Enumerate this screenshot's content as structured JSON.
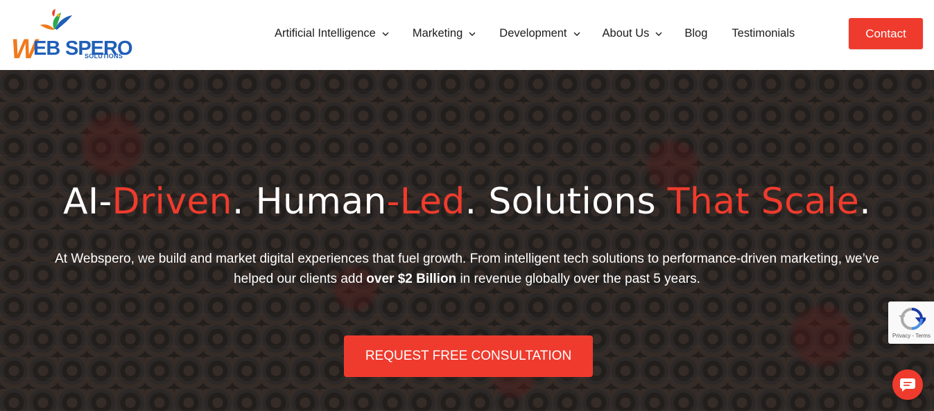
{
  "brand": {
    "logo_w": "W",
    "logo_eb": "EB",
    "logo_spero": "SPERO",
    "logo_sub": "SOLUTIONS"
  },
  "nav": {
    "items": [
      {
        "label": "Artificial Intelligence",
        "dropdown": true
      },
      {
        "label": "Marketing",
        "dropdown": true
      },
      {
        "label": "Development",
        "dropdown": true
      },
      {
        "label": "About Us",
        "dropdown": true
      },
      {
        "label": "Blog",
        "dropdown": false
      },
      {
        "label": "Testimonials",
        "dropdown": false
      }
    ],
    "contact_label": "Contact"
  },
  "hero": {
    "title_parts": [
      {
        "text": "AI-",
        "accent": false
      },
      {
        "text": "Driven",
        "accent": true
      },
      {
        "text": ". Human",
        "accent": false
      },
      {
        "text": "-Led",
        "accent": true
      },
      {
        "text": ". Solutions ",
        "accent": false
      },
      {
        "text": "That Scale",
        "accent": true
      },
      {
        "text": ".",
        "accent": false
      }
    ],
    "description_pre": "At Webspero, we build and market digital experiences that fuel growth. From intelligent tech solutions to performance-driven marketing, we’ve helped our clients add ",
    "description_bold": "over $2 Billion",
    "description_post": " in revenue globally over the past 5 years.",
    "cta_label": "REQUEST FREE CONSULTATION"
  },
  "recaptcha": {
    "links": "Privacy - Terms"
  },
  "icons": {
    "chevron": "chevron-down-icon",
    "chat": "chat-icon",
    "recaptcha": "recaptcha-icon"
  },
  "colors": {
    "accent": "#ef3b2d",
    "logo_orange": "#f07a1d",
    "logo_blue": "#1f5fb8",
    "nav_text": "#1b1b1b"
  }
}
